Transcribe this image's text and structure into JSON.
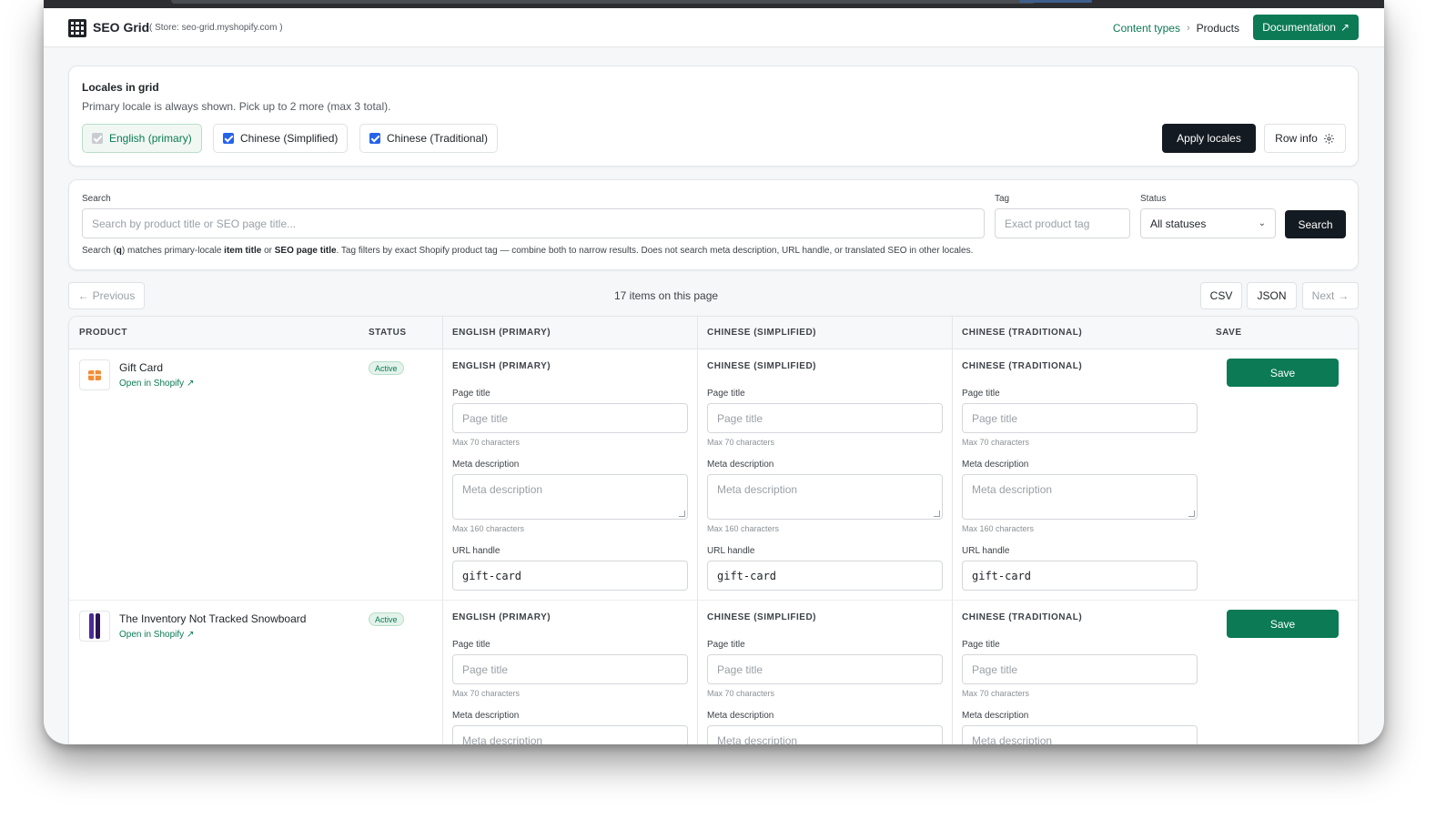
{
  "app": {
    "title": "SEO Grid",
    "store": "( Store: seo-grid.myshopify.com )"
  },
  "breadcrumb": {
    "parent": "Content types",
    "current": "Products"
  },
  "documentation_label": "Documentation",
  "locales": {
    "title": "Locales in grid",
    "subtitle": "Primary locale is always shown. Pick up to 2 more (max 3 total).",
    "options": [
      {
        "label": "English (primary)",
        "checked": true,
        "disabled": true
      },
      {
        "label": "Chinese (Simplified)",
        "checked": true,
        "disabled": false
      },
      {
        "label": "Chinese (Traditional)",
        "checked": true,
        "disabled": false
      }
    ],
    "apply_label": "Apply locales",
    "row_info_label": "Row info"
  },
  "search": {
    "label": "Search",
    "placeholder": "Search by product title or SEO page title...",
    "tag_label": "Tag",
    "tag_placeholder": "Exact product tag",
    "status_label": "Status",
    "status_value": "All statuses",
    "button_label": "Search",
    "help_prefix": "Search (",
    "help_q": "q",
    "help_mid1": ") matches primary-locale ",
    "help_item_title": "item title",
    "help_or": " or ",
    "help_seo_title": "SEO page title",
    "help_rest": ". Tag filters by exact Shopify product tag — combine both to narrow results. Does not search meta description, URL handle, or translated SEO in other locales."
  },
  "pager": {
    "previous": "Previous",
    "summary": "17 items on this page",
    "csv": "CSV",
    "json": "JSON",
    "next": "Next"
  },
  "table": {
    "headers": [
      "PRODUCT",
      "STATUS",
      "ENGLISH (PRIMARY)",
      "CHINESE (SIMPLIFIED)",
      "CHINESE (TRADITIONAL)",
      "SAVE"
    ],
    "field_labels": {
      "page_title": "Page title",
      "page_title_placeholder": "Page title",
      "page_title_hint": "Max 70 characters",
      "meta_description": "Meta description",
      "meta_description_placeholder": "Meta description",
      "meta_description_hint": "Max 160 characters",
      "url_handle": "URL handle"
    },
    "open_link": "Open in Shopify",
    "save_label": "Save",
    "rows": [
      {
        "name": "Gift Card",
        "status": "Active",
        "thumbnail": "gift-card-icon",
        "locales": [
          {
            "label": "ENGLISH (PRIMARY)",
            "handle": "gift-card"
          },
          {
            "label": "CHINESE (SIMPLIFIED)",
            "handle": "gift-card"
          },
          {
            "label": "CHINESE (TRADITIONAL)",
            "handle": "gift-card"
          }
        ]
      },
      {
        "name": "The Inventory Not Tracked Snowboard",
        "status": "Active",
        "thumbnail": "snowboard-icon",
        "locales": [
          {
            "label": "ENGLISH (PRIMARY)"
          },
          {
            "label": "CHINESE (SIMPLIFIED)"
          },
          {
            "label": "CHINESE (TRADITIONAL)"
          }
        ]
      }
    ]
  },
  "colors": {
    "brand_green": "#0b7a55",
    "dark_button": "#141a21",
    "checkbox_blue": "#2563eb"
  }
}
